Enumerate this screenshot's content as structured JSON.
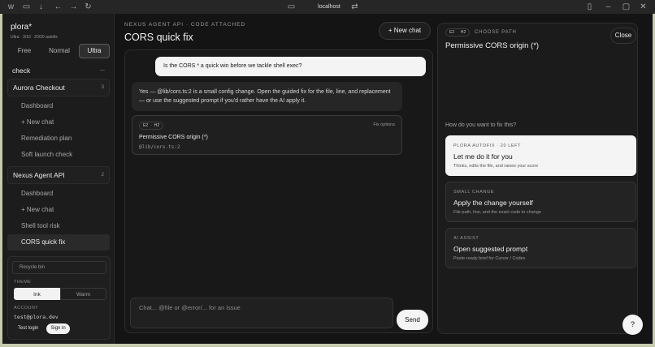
{
  "browser": {
    "url": "localhost"
  },
  "sidebar": {
    "brand": "plora*",
    "subtitle": "Ultra · 3/10 · 20/20 autofix",
    "tiers": [
      "Free",
      "Normal",
      "Ultra"
    ],
    "section_header": "check",
    "groups": [
      {
        "name": "Aurora Checkout",
        "count": "3",
        "items": [
          "Dashboard",
          "+ New chat",
          "Remediation plan",
          "Soft launch check"
        ]
      },
      {
        "name": "Nexus Agent API",
        "count": "2",
        "items": [
          "Dashboard",
          "+ New chat",
          "Shell tool risk",
          "CORS quick fix"
        ]
      }
    ],
    "recycle_placeholder": "Recycle bin",
    "theme_label": "THEME",
    "theme_options": [
      "Ink",
      "Warm"
    ],
    "account_label": "ACCOUNT",
    "account_email": "test@plora.dev",
    "test_login": "Test login",
    "sign_in": "Sign in"
  },
  "main": {
    "eyebrow": "NEXUS AGENT API · CODE ATTACHED",
    "title": "CORS quick fix",
    "new_chat": "+ New chat",
    "user_message": "Is the CORS * a quick win before we tackle shell exec?",
    "assistant_message": "Yes — @lib/cors.ts:2 is a small config change. Open the guided fix for the file, line, and replacement — or use the suggested prompt if you'd rather have the AI apply it.",
    "fix_card": {
      "chip_a": "E2",
      "chip_b": "H2",
      "options_label": "Fix options",
      "name": "Permissive CORS origin (*)",
      "path": "@lib/cors.ts:2"
    },
    "composer_placeholder": "Chat... @file or @error/... for an issue",
    "send": "Send"
  },
  "panel": {
    "chip_a": "E2",
    "chip_b": "H2",
    "eyebrow": "CHOOSE PATH",
    "title": "Permissive CORS origin (*)",
    "close": "Close",
    "question": "How do you want to fix this?",
    "options": [
      {
        "tag": "PLORA AUTOFIX · 20 LEFT",
        "title": "Let me do it for you",
        "desc": "Thinks, edits the file, and raises your score"
      },
      {
        "tag": "SMALL CHANGE",
        "title": "Apply the change yourself",
        "desc": "File path, line, and the exact code to change"
      },
      {
        "tag": "AI ASSIST",
        "title": "Open suggested prompt",
        "desc": "Paste-ready brief for Cursor / Codex"
      }
    ]
  },
  "help": "?"
}
